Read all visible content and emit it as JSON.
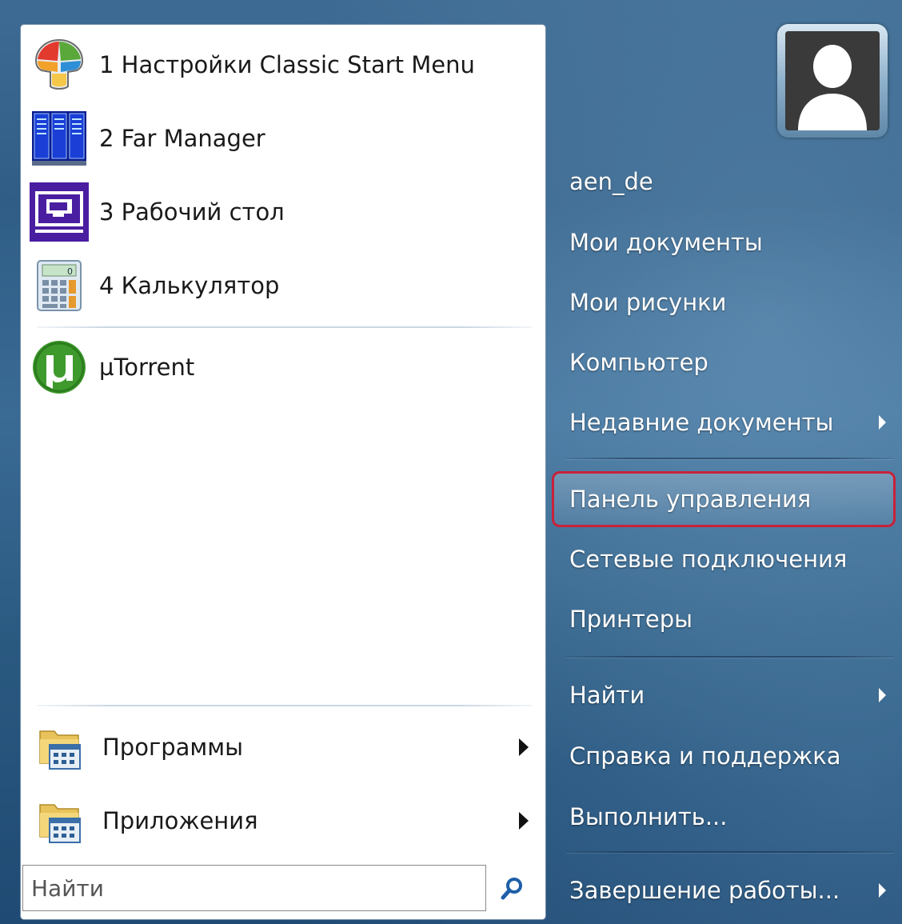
{
  "recent_programs": [
    {
      "label": "1 Настройки Classic Start Menu",
      "icon": "classic-shell-icon"
    },
    {
      "label": "2 Far Manager",
      "icon": "far-manager-icon"
    },
    {
      "label": "3 Рабочий стол",
      "icon": "desktop-icon"
    },
    {
      "label": "4 Калькулятор",
      "icon": "calculator-icon"
    }
  ],
  "pinned_programs": [
    {
      "label": "µTorrent",
      "icon": "utorrent-icon"
    }
  ],
  "bottom_menu": [
    {
      "label": "Программы",
      "icon": "programs-folder-icon"
    },
    {
      "label": "Приложения",
      "icon": "apps-folder-icon"
    }
  ],
  "search": {
    "placeholder": "Найти",
    "icon": "search-icon"
  },
  "user": {
    "name": "aen_de",
    "avatar_icon": "user-avatar-icon"
  },
  "right_menu": [
    {
      "label": "Мои документы"
    },
    {
      "label": "Мои рисунки"
    },
    {
      "label": "Компьютер"
    },
    {
      "label": "Недавние документы",
      "submenu": true
    },
    {
      "label": "Панель управления",
      "highlighted": true
    },
    {
      "label": "Сетевые подключения"
    },
    {
      "label": "Принтеры"
    },
    {
      "label": "Найти",
      "submenu": true
    },
    {
      "label": "Справка и поддержка"
    },
    {
      "label": "Выполнить..."
    },
    {
      "label": "Завершение работы...",
      "submenu": true
    }
  ],
  "colors": {
    "highlight_border": "#c8223a",
    "panel_blue": "#2f5d86"
  }
}
